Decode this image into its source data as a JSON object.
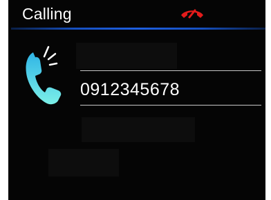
{
  "header": {
    "title": "Calling",
    "hangup_icon": "hang-up-icon",
    "hangup_color": "#e31b1b",
    "accent_line_color": "#1e5fe0"
  },
  "call": {
    "phone_icon": "phone-ringing-icon",
    "icon_color": "#4fd8f0",
    "number": "0912345678"
  },
  "colors": {
    "background": "#050505",
    "text": "#ffffff",
    "separator": "#c8c8c8"
  }
}
